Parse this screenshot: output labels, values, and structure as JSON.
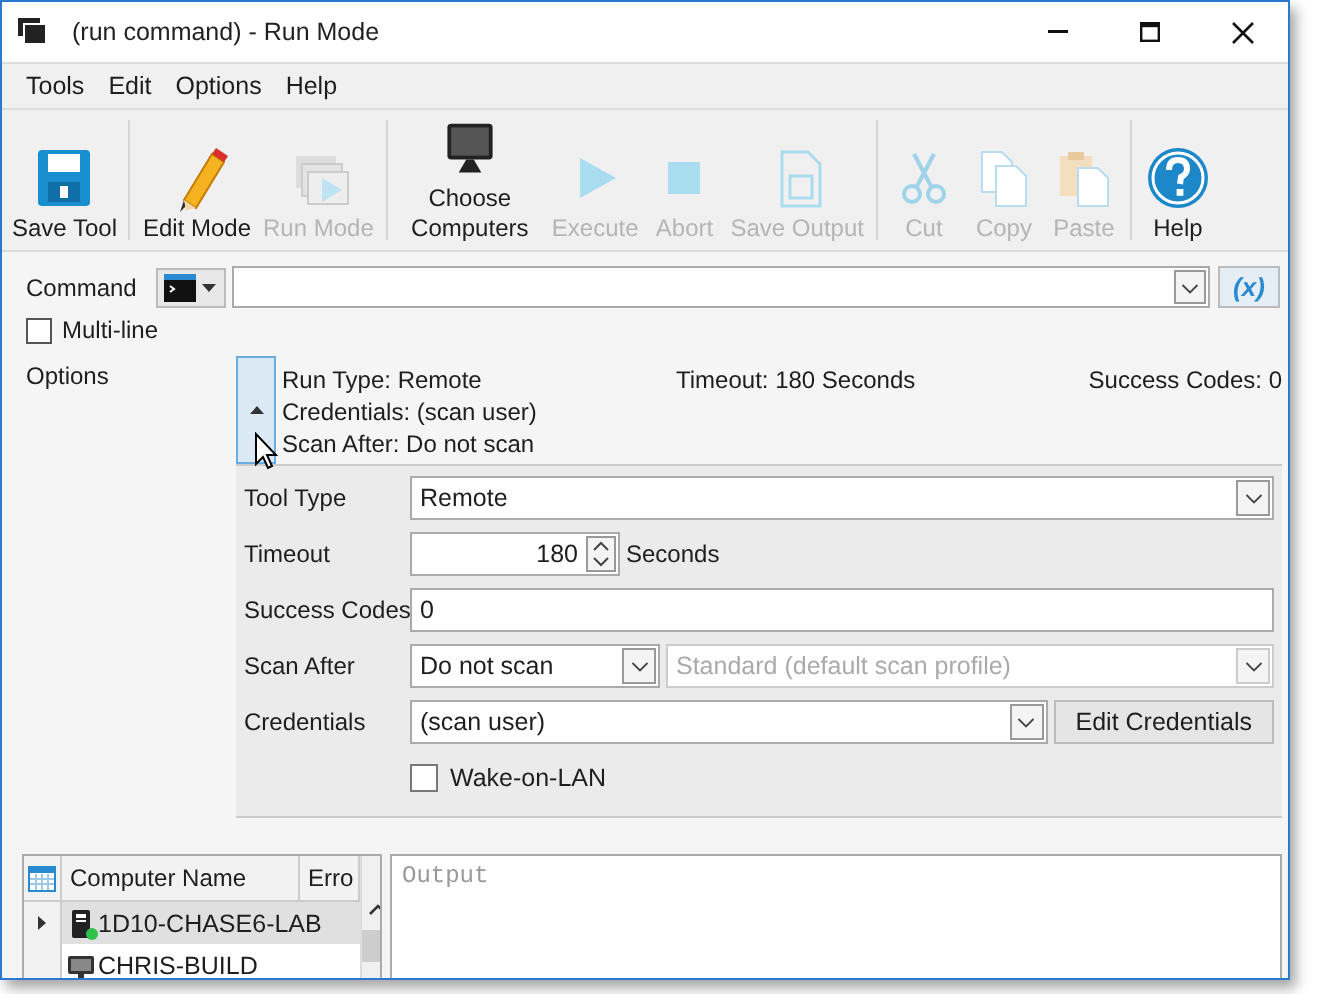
{
  "window": {
    "title": "(run command) - Run Mode"
  },
  "menu": [
    "Tools",
    "Edit",
    "Options",
    "Help"
  ],
  "toolbar": [
    [
      {
        "label": "Save Tool",
        "disabled": false
      }
    ],
    [
      {
        "label": "Edit Mode",
        "disabled": false
      },
      {
        "label": "Run Mode",
        "disabled": true
      }
    ],
    [
      {
        "label": "Choose Computers",
        "disabled": false
      },
      {
        "label": "Execute",
        "disabled": true
      },
      {
        "label": "Abort",
        "disabled": true
      },
      {
        "label": "Save Output",
        "disabled": true
      }
    ],
    [
      {
        "label": "Cut",
        "disabled": true
      },
      {
        "label": "Copy",
        "disabled": true
      },
      {
        "label": "Paste",
        "disabled": true
      }
    ],
    [
      {
        "label": "Help",
        "disabled": false
      }
    ]
  ],
  "command": {
    "label": "Command",
    "variables_button": "(x)",
    "multiline": {
      "label": "Multi-line",
      "checked": false
    }
  },
  "options": {
    "label": "Options",
    "expanded": true,
    "summary": {
      "column_1": [
        "Run Type: Remote",
        "Credentials: (scan user)",
        "Scan After: Do not scan"
      ],
      "column_2": [
        "Timeout: 180 Seconds"
      ],
      "column_3": [
        "Success Codes: 0"
      ]
    },
    "fields": [
      {
        "kind": "dropdown",
        "label": "Tool Type",
        "value": "Remote"
      },
      {
        "kind": "spinner",
        "label": "Timeout",
        "value": "180",
        "unit": "Seconds"
      },
      {
        "kind": "text",
        "label": "Success Codes",
        "value": "0"
      },
      {
        "kind": "dual-dropdown",
        "label": "Scan After",
        "value": "Do not scan",
        "second": {
          "value": "Standard (default scan profile)",
          "disabled": true
        }
      },
      {
        "kind": "dropdown-button",
        "label": "Credentials",
        "value": "(scan user)",
        "button": "Edit Credentials"
      },
      {
        "kind": "checkbox",
        "label": "Wake-on-LAN",
        "checked": false
      }
    ]
  },
  "computers": {
    "columns": [
      "Computer Name",
      "Erro"
    ],
    "rows": [
      {
        "name": "1D10-CHASE6-LAB",
        "kind": "server",
        "selected": true,
        "online": true
      },
      {
        "name": "CHRIS-BUILD",
        "kind": "workstation",
        "selected": false,
        "online": false
      }
    ]
  },
  "output": {
    "placeholder": "Output"
  }
}
